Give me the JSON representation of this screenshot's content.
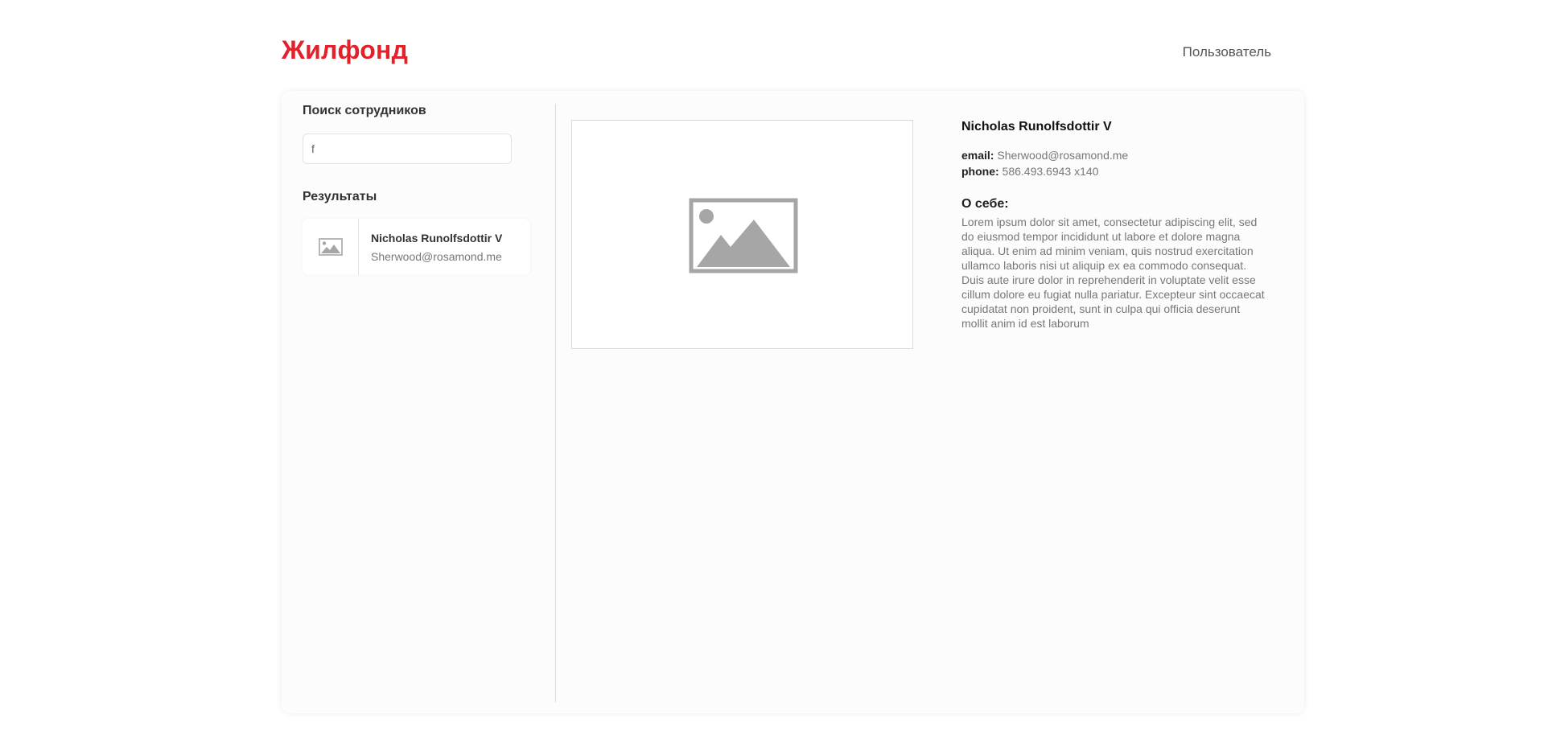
{
  "header": {
    "logo": "Жилфонд",
    "user_link": "Пользователь"
  },
  "sidebar": {
    "search_title": "Поиск сотрудников",
    "search": {
      "value": "f",
      "placeholder": ""
    },
    "results_title": "Результаты",
    "results": [
      {
        "name": "Nicholas Runolfsdottir V",
        "email": "Sherwood@rosamond.me",
        "thumb_icon": "image-placeholder-icon"
      }
    ]
  },
  "detail": {
    "photo_icon": "image-placeholder-icon",
    "name": "Nicholas Runolfsdottir V",
    "email_label": "email:",
    "email": "Sherwood@rosamond.me",
    "phone_label": "phone:",
    "phone": "586.493.6943 x140",
    "about_title": "О себе:",
    "about_text": "Lorem ipsum dolor sit amet, consectetur adipiscing elit, sed do eiusmod tempor incididunt ut labore et dolore magna aliqua. Ut enim ad minim veniam, quis nostrud exercitation ullamco laboris nisi ut aliquip ex ea commodo consequat. Duis aute irure dolor in reprehenderit in voluptate velit esse cillum dolore eu fugiat nulla pariatur. Excepteur sint occaecat cupidatat non proident, sunt in culpa qui officia deserunt mollit anim id est laborum"
  },
  "colors": {
    "brand": "#e3212b",
    "placeholder_gray": "#a6a6a6"
  }
}
